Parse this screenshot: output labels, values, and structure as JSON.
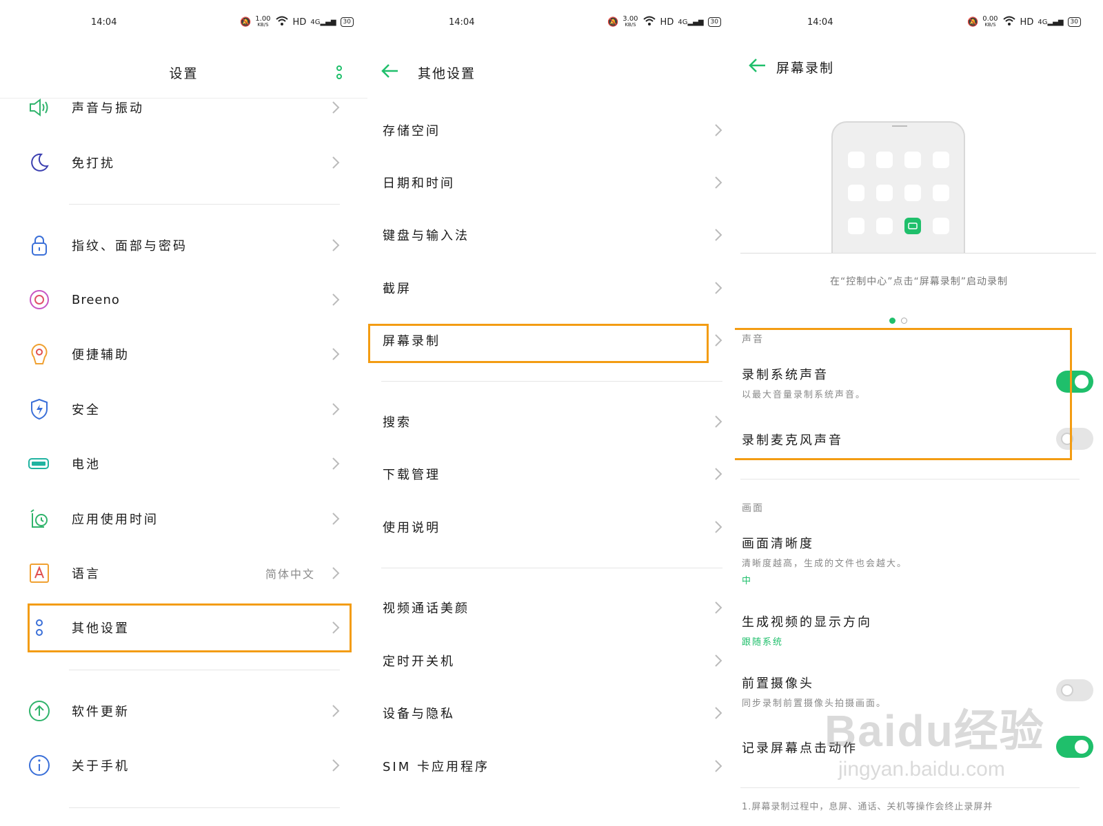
{
  "colors": {
    "accent": "#1fbf6b",
    "highlight": "#f39c12",
    "text": "#1a1a1a",
    "secondary": "#888888"
  },
  "panels": [
    {
      "status": {
        "time": "14:04",
        "speed": "1.00",
        "speed_unit": "KB/S",
        "hd": "HD",
        "net": "4G",
        "battery": "30"
      },
      "title": "设置",
      "items": [
        {
          "label": "声音与振动",
          "icon": "speaker-icon"
        },
        {
          "label": "免打扰",
          "icon": "moon-icon"
        },
        {
          "label": "指纹、面部与密码",
          "icon": "lock-icon"
        },
        {
          "label": "Breeno",
          "icon": "breeno-icon"
        },
        {
          "label": "便捷辅助",
          "icon": "assist-icon"
        },
        {
          "label": "安全",
          "icon": "shield-icon"
        },
        {
          "label": "电池",
          "icon": "battery-icon"
        },
        {
          "label": "应用使用时间",
          "icon": "app-time-icon"
        },
        {
          "label": "语言",
          "value": "简体中文",
          "icon": "language-icon"
        },
        {
          "label": "其他设置",
          "icon": "other-settings-icon"
        },
        {
          "label": "软件更新",
          "icon": "update-icon"
        },
        {
          "label": "关于手机",
          "icon": "info-icon"
        }
      ]
    },
    {
      "status": {
        "time": "14:04",
        "speed": "3.00",
        "speed_unit": "KB/S",
        "hd": "HD",
        "net": "4G",
        "battery": "30"
      },
      "title": "其他设置",
      "items": [
        {
          "label": "存储空间"
        },
        {
          "label": "日期和时间"
        },
        {
          "label": "键盘与输入法"
        },
        {
          "label": "截屏"
        },
        {
          "label": "屏幕录制"
        },
        {
          "label": "搜索"
        },
        {
          "label": "下载管理"
        },
        {
          "label": "使用说明"
        },
        {
          "label": "视频通话美颜"
        },
        {
          "label": "定时开关机"
        },
        {
          "label": "设备与隐私"
        },
        {
          "label": "SIM 卡应用程序"
        }
      ]
    },
    {
      "status": {
        "time": "14:04",
        "speed": "0.00",
        "speed_unit": "KB/S",
        "hd": "HD",
        "net": "4G",
        "battery": "30"
      },
      "title": "屏幕录制",
      "caption": "在“控制中心”点击“屏幕录制”启动录制",
      "carousel": {
        "page": 1,
        "total": 2
      },
      "sound_header": "声音",
      "record_system_sound": {
        "title": "录制系统声音",
        "subtitle": "以最大音量录制系统声音。",
        "on": true
      },
      "record_mic_sound": {
        "title": "录制麦克风声音",
        "on": false
      },
      "picture_header": "画面",
      "clarity": {
        "title": "画面清晰度",
        "subtitle": "清晰度越高，生成的文件也会越大。",
        "value": "中"
      },
      "orientation": {
        "title": "生成视频的显示方向",
        "value": "跟随系统"
      },
      "front_camera": {
        "title": "前置摄像头",
        "subtitle": "同步录制前置摄像头拍摄画面。",
        "on": false
      },
      "record_touches": {
        "title": "记录屏幕点击动作",
        "on": true
      },
      "footnote": "1.屏幕录制过程中，息屏、通话、关机等操作会终止录屏并",
      "watermark": "Baidu经验",
      "watermark_url": "jingyan.baidu.com"
    }
  ]
}
